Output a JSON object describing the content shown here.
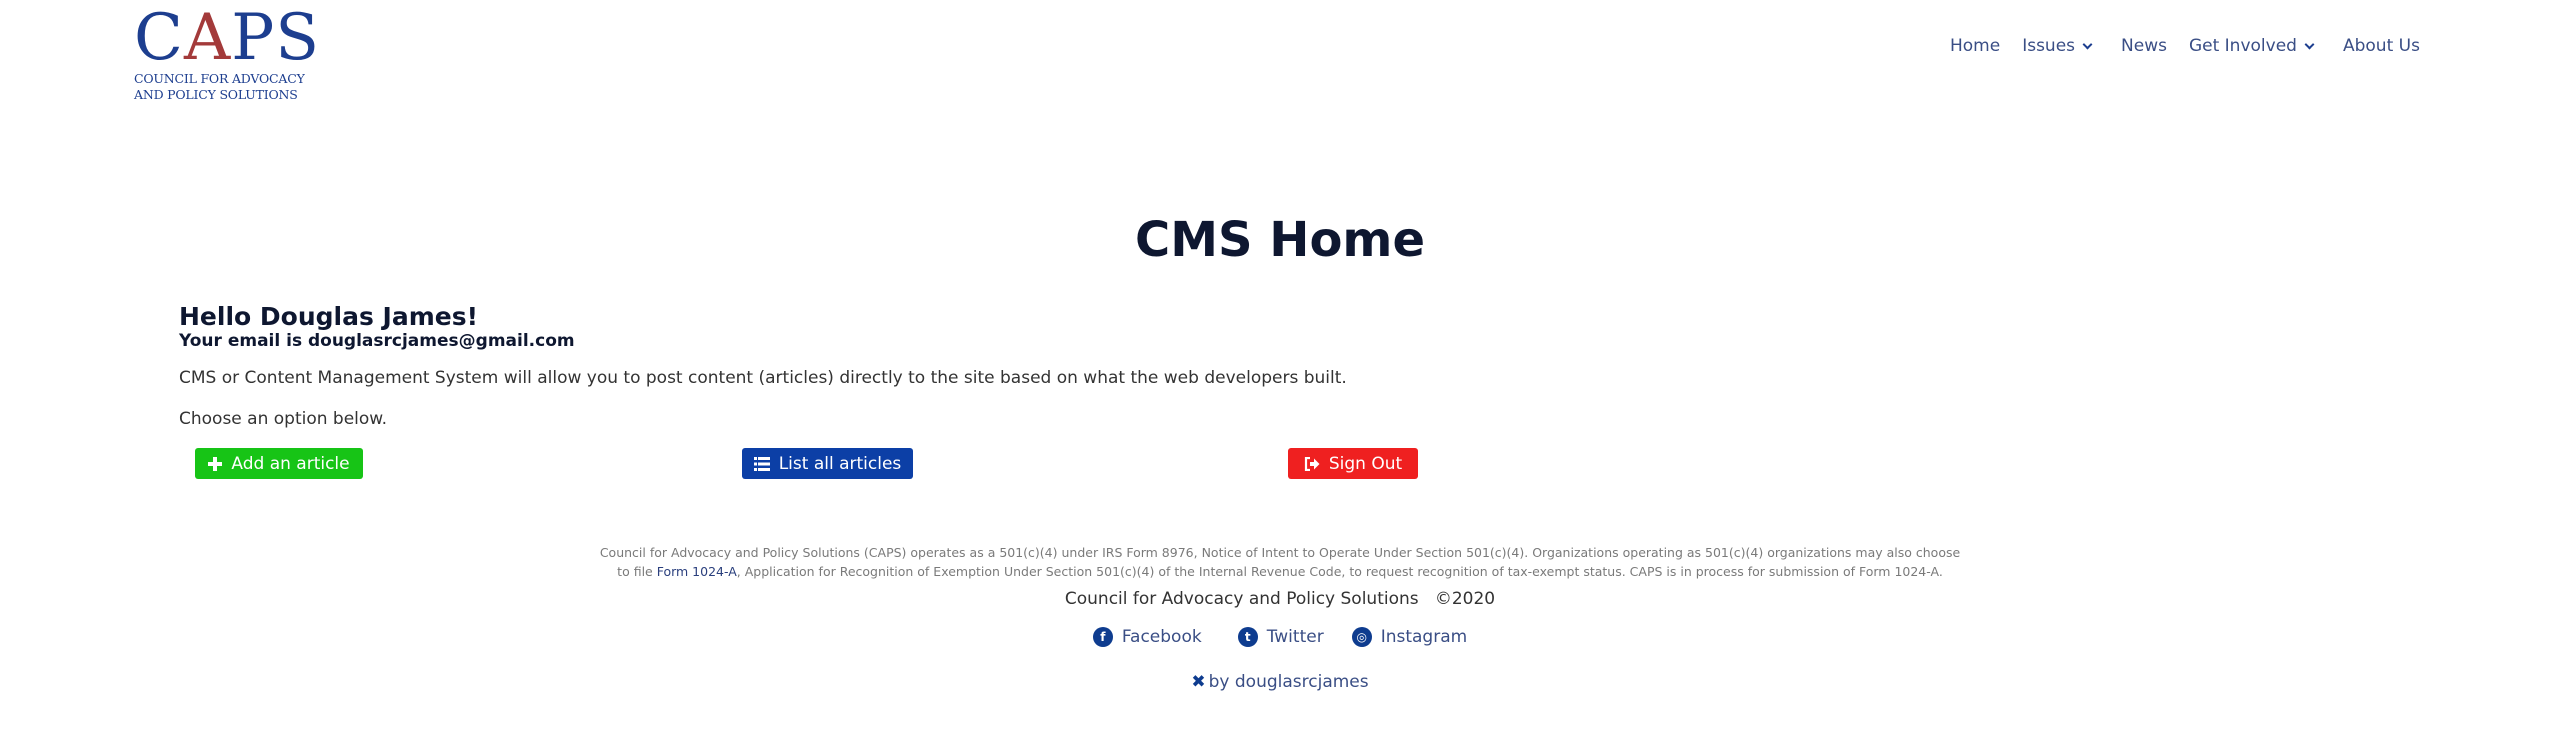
{
  "logo": {
    "name": "CAPS",
    "letters": [
      "C",
      "A",
      "PS"
    ],
    "subtitle_line1": "COUNCIL FOR ADVOCACY",
    "subtitle_line2": "AND POLICY SOLUTIONS",
    "colors": {
      "blue": "#1d3e8f",
      "red": "#a33a3a"
    }
  },
  "nav": {
    "items": [
      {
        "label": "Home",
        "has_dropdown": false
      },
      {
        "label": "Issues",
        "has_dropdown": true
      },
      {
        "label": "News",
        "has_dropdown": false
      },
      {
        "label": "Get Involved",
        "has_dropdown": true
      },
      {
        "label": "About Us",
        "has_dropdown": false
      }
    ]
  },
  "main": {
    "title": "CMS Home",
    "greeting": "Hello Douglas James!",
    "email_line": "Your email is douglasrcjames@gmail.com",
    "description": "CMS or Content Management System will allow you to post content (articles) directly to the site based on what the web developers built.",
    "prompt": "Choose an option below.",
    "buttons": {
      "add": {
        "label": "Add an article",
        "icon": "plus-icon",
        "color": "#17c416"
      },
      "list": {
        "label": "List all articles",
        "icon": "list-icon",
        "color": "#0c3fa6"
      },
      "signout": {
        "label": "Sign Out",
        "icon": "sign-out-icon",
        "color": "#ef2020"
      }
    }
  },
  "footer": {
    "legal_line1": "Council for Advocacy and Policy Solutions (CAPS) operates as a 501(c)(4) under IRS Form 8976, Notice of Intent to Operate Under Section 501(c)(4). Organizations operating as 501(c)(4) organizations may also choose",
    "legal_line2_prefix": "to file ",
    "legal_link": "Form 1024-A",
    "legal_line2_suffix": ", Application for Recognition of Exemption Under Section 501(c)(4) of the Internal Revenue Code, to request recognition of tax-exempt status. CAPS is in process for submission of Form 1024-A.",
    "org_name": "Council for Advocacy and Policy Solutions",
    "copyright": "©2020",
    "social": [
      {
        "label": "Facebook",
        "icon": "facebook-icon",
        "glyph": "f"
      },
      {
        "label": "Twitter",
        "icon": "twitter-icon",
        "glyph": "t"
      },
      {
        "label": "Instagram",
        "icon": "instagram-icon",
        "glyph": "◎"
      }
    ],
    "credit": "by douglasrcjames"
  }
}
